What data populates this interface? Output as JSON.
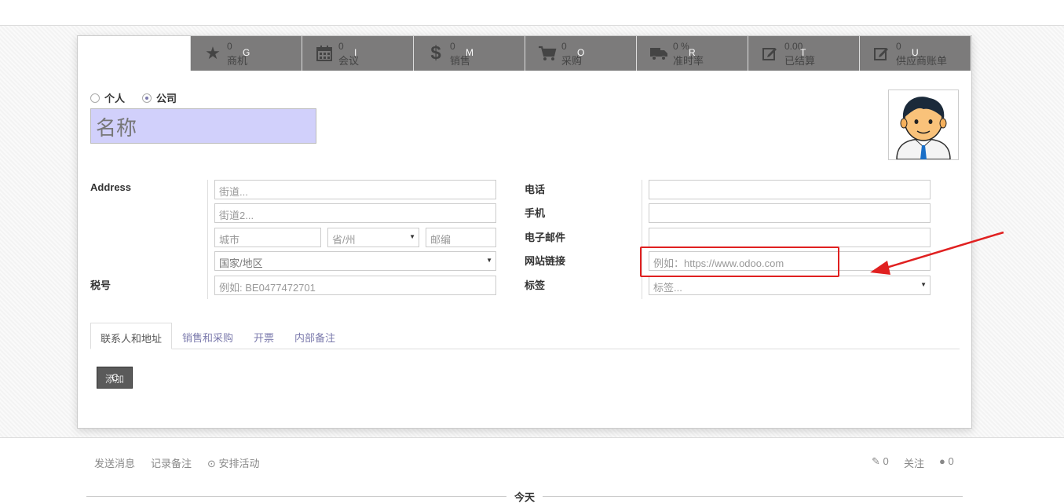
{
  "stat_buttons": [
    {
      "icon": "star-icon",
      "value": "0",
      "label": "商机",
      "key": "G"
    },
    {
      "icon": "calendar-icon",
      "value": "0",
      "label": "会议",
      "key": "I"
    },
    {
      "icon": "dollar-icon",
      "value": "0",
      "label": "销售",
      "key": "M"
    },
    {
      "icon": "cart-icon",
      "value": "0",
      "label": "采购",
      "key": "O"
    },
    {
      "icon": "truck-icon",
      "value": "0 %",
      "label": "准时率",
      "key": "R"
    },
    {
      "icon": "edit-icon",
      "value": "0.00",
      "label": "已结算",
      "key": "T"
    },
    {
      "icon": "edit-icon",
      "value": "0",
      "label": "供应商账单",
      "key": "U"
    }
  ],
  "company_type": {
    "individual": "个人",
    "company": "公司",
    "selected": "company"
  },
  "name_placeholder": "名称",
  "address": {
    "label": "Address",
    "street_placeholder": "街道...",
    "street2_placeholder": "街道2...",
    "city_placeholder": "城市",
    "state_placeholder": "省/州",
    "zip_placeholder": "邮编",
    "country_placeholder": "国家/地区"
  },
  "vat": {
    "label": "税号",
    "placeholder": "例如: BE0477472701"
  },
  "contact": {
    "phone_label": "电话",
    "mobile_label": "手机",
    "email_label": "电子邮件",
    "website_label": "网站链接",
    "website_placeholder": "例如：https://www.odoo.com",
    "tags_label": "标签",
    "tags_placeholder": "标签..."
  },
  "tabs": [
    "联系人和地址",
    "销售和采购",
    "开票",
    "内部备注"
  ],
  "add_button": {
    "label": "添加",
    "key": "C"
  },
  "chatter": {
    "send_message": "发送消息",
    "log_note": "记录备注",
    "schedule_activity": "安排活动",
    "attachments": "0",
    "follow": "关注",
    "followers": "0",
    "today": "今天"
  },
  "colors": {
    "accent": "#7c7bad",
    "name_bg": "#d1d0fb",
    "stat_bg": "#7c7b7b",
    "highlight": "#e02020"
  }
}
